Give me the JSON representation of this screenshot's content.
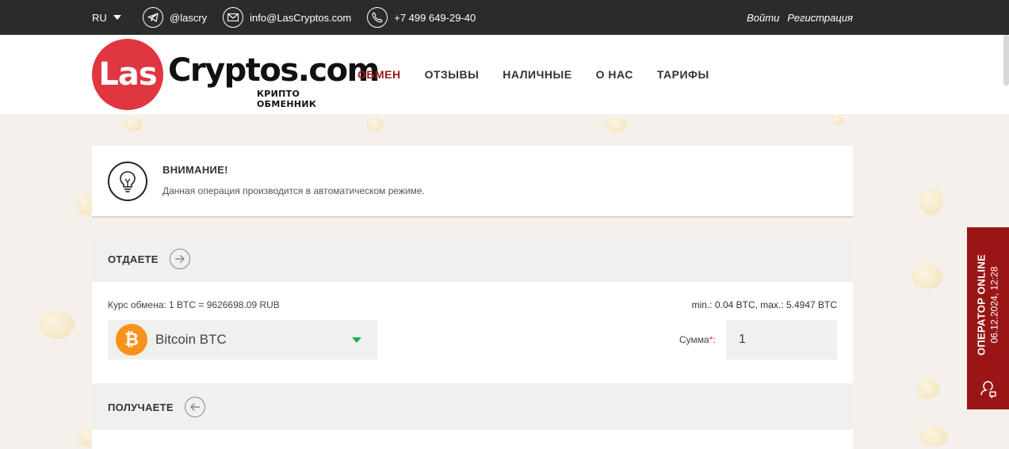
{
  "topbar": {
    "language": "RU",
    "telegram": "@lascry",
    "email": "info@LasCryptos.com",
    "phone": "+7 499 649-29-40",
    "login": "Войти",
    "register": "Регистрация"
  },
  "logo": {
    "circle_text": "Las",
    "word": "Cryptos.com",
    "subtitle": "КРИПТО ОБМЕННИК"
  },
  "nav": {
    "items": [
      "ОБМЕН",
      "ОТЗЫВЫ",
      "НАЛИЧНЫЕ",
      "О НАС",
      "ТАРИФЫ"
    ],
    "active": "ОБМЕН"
  },
  "notice": {
    "title": "ВНИМАНИЕ!",
    "text": "Данная операция производится в автоматическом режиме."
  },
  "give": {
    "title": "ОТДАЕТЕ",
    "rate": "Курс обмена: 1 BTC = 9626698.09 RUB",
    "limits": "min.: 0.04 BTC, max.: 5.4947 BTC",
    "currency": "Bitcoin BTC",
    "sum_label": "Сумма",
    "sum_required_mark": "*",
    "sum_suffix": ":",
    "amount": "1"
  },
  "receive": {
    "title": "ПОЛУЧАЕТЕ"
  },
  "operator": {
    "title": "ОПЕРАТОР ONLINE",
    "datetime": "06.12.2024, 12:28"
  },
  "colors": {
    "accent_red": "#9b1c1c",
    "logo_red": "#e0363f",
    "btc_orange": "#f7931a",
    "caret_green": "#16b24b",
    "topbar_bg": "#2b2b2b"
  },
  "icons": {
    "telegram": "telegram-icon",
    "email": "envelope-icon",
    "phone": "phone-icon",
    "notice": "lightbulb-icon",
    "give_arrow": "arrow-right-icon",
    "receive_arrow": "arrow-left-icon",
    "currency": "bitcoin-icon",
    "operator": "chat-person-icon"
  }
}
